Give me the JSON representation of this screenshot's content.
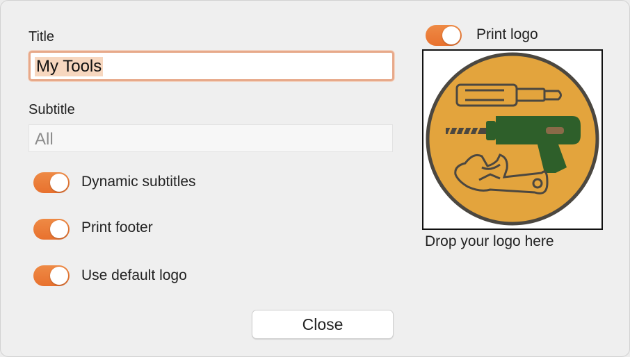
{
  "form": {
    "title_label": "Title",
    "title_value": "My Tools",
    "subtitle_label": "Subtitle",
    "subtitle_placeholder": "All"
  },
  "toggles": {
    "dynamic_subtitles": {
      "label": "Dynamic subtitles",
      "on": true
    },
    "print_footer": {
      "label": "Print footer",
      "on": true
    },
    "use_default_logo": {
      "label": "Use default logo",
      "on": true
    },
    "print_logo": {
      "label": "Print logo",
      "on": true
    }
  },
  "logo": {
    "caption": "Drop your logo here",
    "icon": "tools-logo-icon",
    "colors": {
      "circle": "#e3a43d",
      "outline": "#4b4740",
      "drill": "#2e5f2a"
    }
  },
  "buttons": {
    "close_label": "Close"
  },
  "colors": {
    "accent": "#ea7a36",
    "background": "#efefef"
  }
}
